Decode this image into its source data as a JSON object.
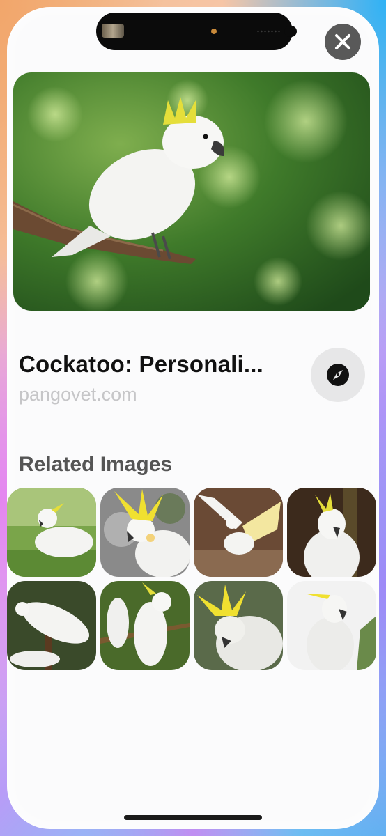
{
  "result": {
    "title": "Cockatoo: Personali...",
    "domain": "pangovet.com"
  },
  "related": {
    "heading": "Related Images",
    "thumbnails": [
      {
        "icon": "cockatoo-grass-thumbnail"
      },
      {
        "icon": "cockatoo-crest-raised-thumbnail"
      },
      {
        "icon": "cockatoo-wings-spread-thumbnail"
      },
      {
        "icon": "cockatoo-front-thumbnail"
      },
      {
        "icon": "cockatoo-pair-perch-thumbnail"
      },
      {
        "icon": "cockatoo-two-birds-thumbnail"
      },
      {
        "icon": "cockatoo-closeup-thumbnail"
      },
      {
        "icon": "cockatoo-white-background-thumbnail"
      }
    ]
  },
  "icons": {
    "close": "close-icon",
    "open_safari": "compass-icon"
  },
  "colors": {
    "close_button_bg": "#595959",
    "open_button_bg": "#e7e7e8",
    "title_text": "#111111",
    "domain_text": "#c6c6c8",
    "section_heading": "#555555"
  }
}
